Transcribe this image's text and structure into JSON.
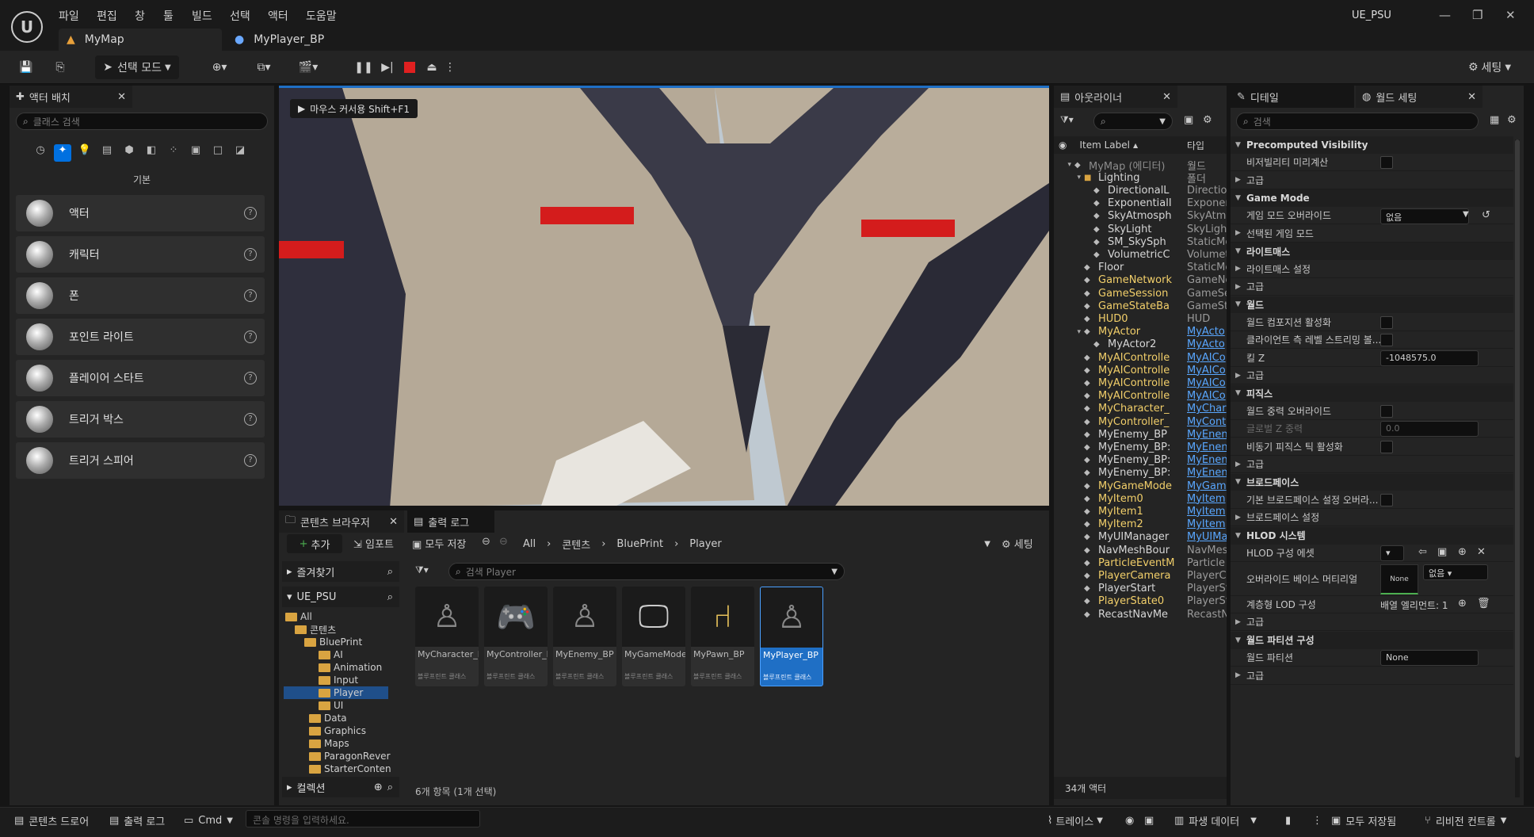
{
  "app": {
    "project": "UE_PSU",
    "menu": [
      "파일",
      "편집",
      "창",
      "툴",
      "빌드",
      "선택",
      "액터",
      "도움말"
    ],
    "tabs": {
      "map": "MyMap",
      "bp": "MyPlayer_BP"
    }
  },
  "toolbar": {
    "select_mode": "선택 모드",
    "settings": "세팅"
  },
  "place_actors": {
    "tab": "액터 배치",
    "search": "클래스 검색",
    "category": "기본",
    "items": [
      "액터",
      "캐릭터",
      "폰",
      "포인트 라이트",
      "플레이어 스타트",
      "트리거 박스",
      "트리거 스피어"
    ]
  },
  "viewport": {
    "hint": "마우스 커서용 Shift+F1"
  },
  "outliner": {
    "tab": "아웃라이너",
    "col_label": "Item Label",
    "col_type": "타입",
    "count": "34개 액터",
    "rows": [
      [
        "MyMap (에디터)",
        "월드"
      ],
      [
        "Lighting",
        "폴더"
      ],
      [
        "DirectionalL",
        "Direction"
      ],
      [
        "ExponentialI",
        "Exponer"
      ],
      [
        "SkyAtmosph",
        "SkyAtmo"
      ],
      [
        "SkyLight",
        "SkyLigh"
      ],
      [
        "SM_SkySph",
        "StaticMe"
      ],
      [
        "VolumetricC",
        "Volumet"
      ],
      [
        "Floor",
        "StaticMe"
      ],
      [
        "GameNetwork",
        "GameNe"
      ],
      [
        "GameSession",
        "GameSe"
      ],
      [
        "GameStateBa",
        "GameSt"
      ],
      [
        "HUD0",
        "HUD"
      ],
      [
        "MyActor",
        "MyActo"
      ],
      [
        "MyActor2",
        "MyActo"
      ],
      [
        "MyAIControlle",
        "MyAICo"
      ],
      [
        "MyAIControlle",
        "MyAICo"
      ],
      [
        "MyAIControlle",
        "MyAICo"
      ],
      [
        "MyAIControlle",
        "MyAICo"
      ],
      [
        "MyCharacter_",
        "MyChar"
      ],
      [
        "MyController_",
        "MyCont"
      ],
      [
        "MyEnemy_BP",
        "MyEnen"
      ],
      [
        "MyEnemy_BP:",
        "MyEnen"
      ],
      [
        "MyEnemy_BP:",
        "MyEnen"
      ],
      [
        "MyEnemy_BP:",
        "MyEnen"
      ],
      [
        "MyGameMode",
        "MyGam"
      ],
      [
        "MyItem0",
        "MyItem"
      ],
      [
        "MyItem1",
        "MyItem"
      ],
      [
        "MyItem2",
        "MyItem"
      ],
      [
        "MyUIManager",
        "MyUIMa"
      ],
      [
        "NavMeshBour",
        "NavMes"
      ],
      [
        "ParticleEventM",
        "Particle"
      ],
      [
        "PlayerCamera",
        "PlayerCa"
      ],
      [
        "PlayerStart",
        "PlayerSt"
      ],
      [
        "PlayerState0",
        "PlayerSt"
      ],
      [
        "RecastNavMe",
        "RecastN"
      ]
    ]
  },
  "details": {
    "tab1": "디테일",
    "tab2": "월드 세팅",
    "search": "검색",
    "rows": [
      [
        "sec",
        "Precomputed Visibility"
      ],
      [
        "chk",
        "비저빌리티 미리계산"
      ],
      [
        "sub",
        "고급"
      ],
      [
        "sec",
        "Game Mode"
      ],
      [
        "drop",
        "게임 모드 오버라이드",
        "없음"
      ],
      [
        "sub",
        "선택된 게임 모드"
      ],
      [
        "sec",
        "라이트매스"
      ],
      [
        "sub",
        "라이트매스 설정"
      ],
      [
        "sub",
        "고급"
      ],
      [
        "sec",
        "월드"
      ],
      [
        "chk",
        "월드 컴포지션 활성화"
      ],
      [
        "chk",
        "클라이언트 측 레벨 스트리밍 볼..."
      ],
      [
        "val",
        "킬 Z",
        "-1048575.0"
      ],
      [
        "sub",
        "고급"
      ],
      [
        "sec",
        "피직스"
      ],
      [
        "chk",
        "월드 중력 오버라이드"
      ],
      [
        "valg",
        "글로벌 Z 중력",
        "0.0"
      ],
      [
        "chk",
        "비동기 피직스 틱 활성화"
      ],
      [
        "sub",
        "고급"
      ],
      [
        "sec",
        "브로드페이스"
      ],
      [
        "chk",
        "기본 브로드페이스 설정 오버라..."
      ],
      [
        "sub",
        "브로드페이스 설정"
      ],
      [
        "sec",
        "HLOD 시스템"
      ],
      [
        "drop2",
        "HLOD 구성 에셋",
        ""
      ],
      [
        "tall",
        "오버라이드 베이스 머티리얼",
        "None",
        "없음"
      ],
      [
        "arr",
        "계층형 LOD 구성",
        "배열 엘리먼트: 1"
      ],
      [
        "sub",
        "고급"
      ],
      [
        "sec",
        "월드 파티션 구성"
      ],
      [
        "val",
        "월드 파티션",
        "None"
      ],
      [
        "sub",
        "고급"
      ]
    ]
  },
  "content": {
    "tab": "콘텐츠 브라우저",
    "log_tab": "출력 로그",
    "add": "추가",
    "import": "임포트",
    "save_all": "모두 저장",
    "path": [
      "All",
      "콘텐츠",
      "BluePrint",
      "Player"
    ],
    "settings": "세팅",
    "favorites": "즐겨찾기",
    "project": "UE_PSU",
    "search": "검색 Player",
    "collections": "컬렉션",
    "status": "6개 항목 (1개 선택)",
    "tree": [
      "All",
      "콘텐츠",
      "BluePrint",
      "AI",
      "Animation",
      "Input",
      "Player",
      "UI",
      "Data",
      "Graphics",
      "Maps",
      "ParagonRever",
      "StarterConten"
    ],
    "assets": [
      [
        "MyCharacter_BP",
        "블루프린트 클래스"
      ],
      [
        "MyController_BP",
        "블루프린트 클래스"
      ],
      [
        "MyEnemy_BP",
        "블루프린트 클래스"
      ],
      [
        "MyGameModeBase_BP",
        "블루프린트 클래스"
      ],
      [
        "MyPawn_BP",
        "블루프린트 클래스"
      ],
      [
        "MyPlayer_BP",
        "블루프린트 클래스"
      ]
    ]
  },
  "status": {
    "drawer": "콘텐츠 드로어",
    "log": "출력 로그",
    "cmd": "Cmd",
    "console": "콘솔 명령을 입력하세요.",
    "trace": "트레이스",
    "derived": "파생 데이터",
    "save_all": "모두 저장됨",
    "revision": "리비전 컨트롤"
  },
  "colors": {
    "accent": "#0070e0",
    "selected": "#1f6fc5",
    "folder": "#d9a441",
    "link": "#59a7ff"
  }
}
